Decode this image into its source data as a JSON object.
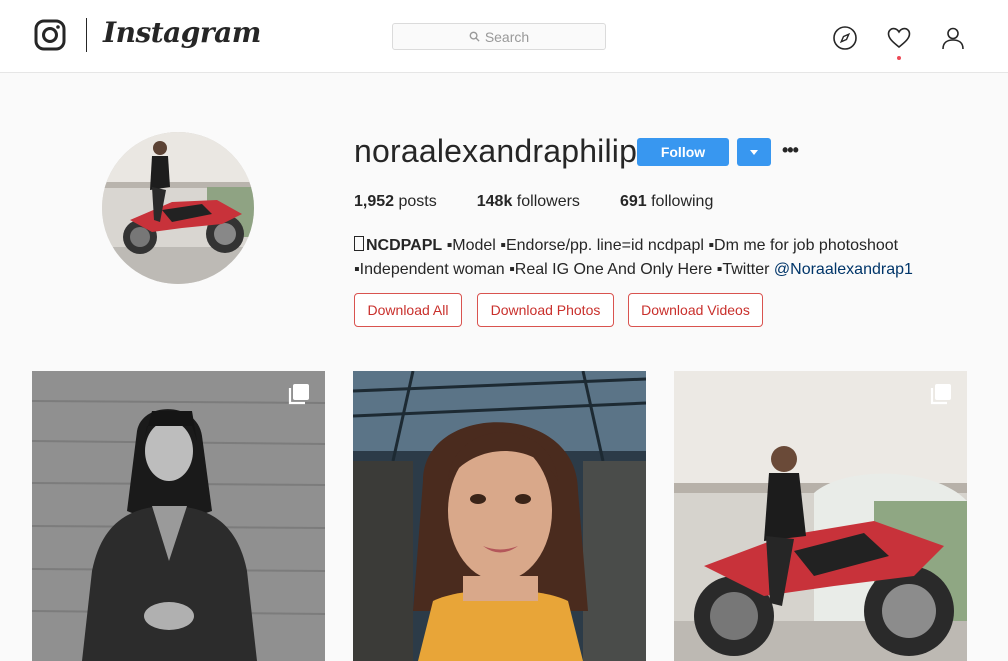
{
  "header": {
    "wordmark": "Instagram",
    "search_placeholder": "Search",
    "icons": [
      "instagram-glyph-icon",
      "compass-icon",
      "heart-icon",
      "person-icon"
    ]
  },
  "profile": {
    "username": "noraalexandraphilip",
    "follow_label": "Follow",
    "stats": {
      "posts_count": "1,952",
      "posts_label": "posts",
      "followers_count": "148k",
      "followers_label": "followers",
      "following_count": "691",
      "following_label": "following"
    },
    "bio": {
      "line1_strong": "NCDPAPL",
      "line1_rest": " ▪Model ▪Endorse/pp. line=id ncdpapl ▪Dm me for job photoshoot",
      "line2_text": "▪Independent woman ▪Real IG One And Only Here ▪Twitter ",
      "line2_link": "@Noraalexandrap1"
    },
    "download_buttons": [
      "Download All",
      "Download Photos",
      "Download Videos"
    ]
  },
  "posts": [
    {
      "type": "multiple",
      "description": "black-and-white portrait against wall"
    },
    {
      "type": "single",
      "description": "smiling woman with wavy hair"
    },
    {
      "type": "multiple",
      "description": "woman on red motorcycle"
    }
  ],
  "colors": {
    "accent": "#3897f0",
    "download_border": "#d9534f",
    "notification_dot": "#ed4956"
  }
}
